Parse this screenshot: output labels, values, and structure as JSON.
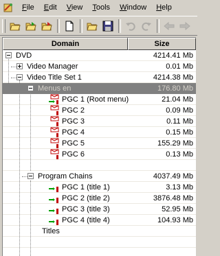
{
  "menu": {
    "items": [
      {
        "label": "File",
        "accel": "F",
        "rest": "ile"
      },
      {
        "label": "Edit",
        "accel": "E",
        "rest": "dit"
      },
      {
        "label": "View",
        "accel": "V",
        "rest": "iew"
      },
      {
        "label": "Tools",
        "accel": "T",
        "rest": "ools"
      },
      {
        "label": "Window",
        "accel": "W",
        "rest": "indow"
      },
      {
        "label": "Help",
        "accel": "H",
        "rest": "elp"
      }
    ]
  },
  "toolbar": {
    "buttons": [
      "open-folder-icon",
      "open-green-icon",
      "open-red-icon",
      "new-document-icon",
      "open-icon",
      "save-icon",
      "undo-icon",
      "redo-icon",
      "back-icon",
      "forward-icon"
    ]
  },
  "table": {
    "col_domain": "Domain",
    "col_size": "Size",
    "rows": [
      {
        "name": "DVD",
        "size": "4214.41 Mb"
      },
      {
        "name": "Video Manager",
        "size": "0.01 Mb"
      },
      {
        "name": "Video Title Set 1",
        "size": "4214.38 Mb"
      },
      {
        "name": "Menus en",
        "size": "176.80 Mb"
      },
      {
        "name": "PGC 1 (Root menu)",
        "size": "21.04 Mb"
      },
      {
        "name": "PGC 2",
        "size": "0.09 Mb"
      },
      {
        "name": "PGC 3",
        "size": "0.11 Mb"
      },
      {
        "name": "PGC 4",
        "size": "0.15 Mb"
      },
      {
        "name": "PGC 5",
        "size": "155.29 Mb"
      },
      {
        "name": "PGC 6",
        "size": "0.13 Mb"
      },
      {
        "name": "Program Chains",
        "size": "4037.49 Mb"
      },
      {
        "name": "PGC 1  (title 1)",
        "size": "3.13 Mb"
      },
      {
        "name": "PGC 2  (title 2)",
        "size": "3876.48 Mb"
      },
      {
        "name": "PGC 3  (title 3)",
        "size": "52.95 Mb"
      },
      {
        "name": "PGC 4  (title 4)",
        "size": "104.93 Mb"
      },
      {
        "name": "Titles",
        "size": ""
      }
    ]
  }
}
